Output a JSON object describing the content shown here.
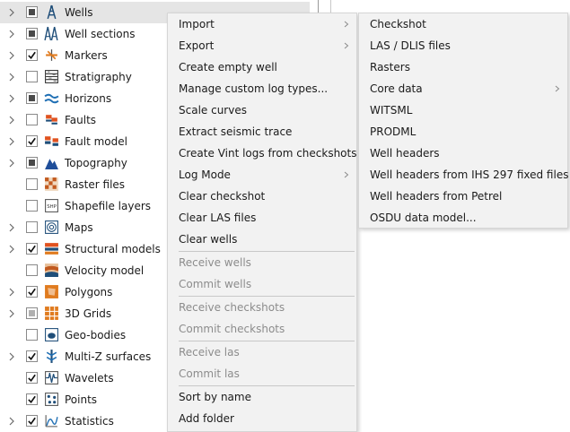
{
  "tree": {
    "items": [
      {
        "label": "Wells",
        "state": "ind",
        "expander": true,
        "icon": "well-icon",
        "selected": true
      },
      {
        "label": "Well sections",
        "state": "ind",
        "expander": true,
        "icon": "well-section-icon"
      },
      {
        "label": "Markers",
        "state": "checked",
        "expander": true,
        "icon": "markers-icon"
      },
      {
        "label": "Stratigraphy",
        "state": "unchecked",
        "expander": true,
        "icon": "stratigraphy-icon"
      },
      {
        "label": "Horizons",
        "state": "ind",
        "expander": true,
        "icon": "horizons-icon"
      },
      {
        "label": "Faults",
        "state": "unchecked",
        "expander": true,
        "icon": "faults-icon"
      },
      {
        "label": "Fault model",
        "state": "checked",
        "expander": true,
        "icon": "fault-model-icon"
      },
      {
        "label": "Topography",
        "state": "ind",
        "expander": true,
        "icon": "topography-icon"
      },
      {
        "label": "Raster files",
        "state": "unchecked",
        "expander": false,
        "icon": "raster-icon"
      },
      {
        "label": "Shapefile layers",
        "state": "unchecked",
        "expander": false,
        "icon": "shapefile-icon"
      },
      {
        "label": "Maps",
        "state": "unchecked",
        "expander": true,
        "icon": "maps-icon"
      },
      {
        "label": "Structural models",
        "state": "checked",
        "expander": true,
        "icon": "structural-models-icon"
      },
      {
        "label": "Velocity model",
        "state": "unchecked",
        "expander": false,
        "icon": "velocity-model-icon"
      },
      {
        "label": "Polygons",
        "state": "checked",
        "expander": true,
        "icon": "polygons-icon"
      },
      {
        "label": "3D Grids",
        "state": "ind-light",
        "expander": true,
        "icon": "grids-icon"
      },
      {
        "label": "Geo-bodies",
        "state": "unchecked",
        "expander": false,
        "icon": "geobodies-icon"
      },
      {
        "label": "Multi-Z surfaces",
        "state": "checked",
        "expander": true,
        "icon": "multiz-icon"
      },
      {
        "label": "Wavelets",
        "state": "checked",
        "expander": false,
        "icon": "wavelets-icon"
      },
      {
        "label": "Points",
        "state": "checked",
        "expander": false,
        "icon": "points-icon"
      },
      {
        "label": "Statistics",
        "state": "checked",
        "expander": true,
        "icon": "statistics-icon"
      }
    ]
  },
  "context_menu": {
    "items": [
      {
        "label": "Import",
        "submenu": true
      },
      {
        "label": "Export",
        "submenu": true
      },
      {
        "label": "Create empty well"
      },
      {
        "label": "Manage custom log types..."
      },
      {
        "label": "Scale curves"
      },
      {
        "label": "Extract seismic trace"
      },
      {
        "label": "Create Vint logs from checkshots"
      },
      {
        "label": "Log Mode",
        "submenu": true
      },
      {
        "label": "Clear checkshot"
      },
      {
        "label": "Clear LAS files"
      },
      {
        "label": "Clear wells"
      },
      {
        "label": "Receive wells",
        "disabled": true
      },
      {
        "label": "Commit wells",
        "disabled": true
      },
      {
        "label": "Receive checkshots",
        "disabled": true
      },
      {
        "label": "Commit checkshots",
        "disabled": true
      },
      {
        "label": "Receive las",
        "disabled": true
      },
      {
        "label": "Commit las",
        "disabled": true
      },
      {
        "label": "Sort by name"
      },
      {
        "label": "Add folder"
      }
    ]
  },
  "import_submenu": {
    "items": [
      {
        "label": "Checkshot"
      },
      {
        "label": "LAS / DLIS files"
      },
      {
        "label": "Rasters"
      },
      {
        "label": "Core data",
        "submenu": true
      },
      {
        "label": "WITSML"
      },
      {
        "label": "PRODML"
      },
      {
        "label": "Well headers"
      },
      {
        "label": "Well headers from IHS 297 fixed files"
      },
      {
        "label": "Well headers from Petrel"
      },
      {
        "label": "OSDU data model..."
      }
    ]
  }
}
